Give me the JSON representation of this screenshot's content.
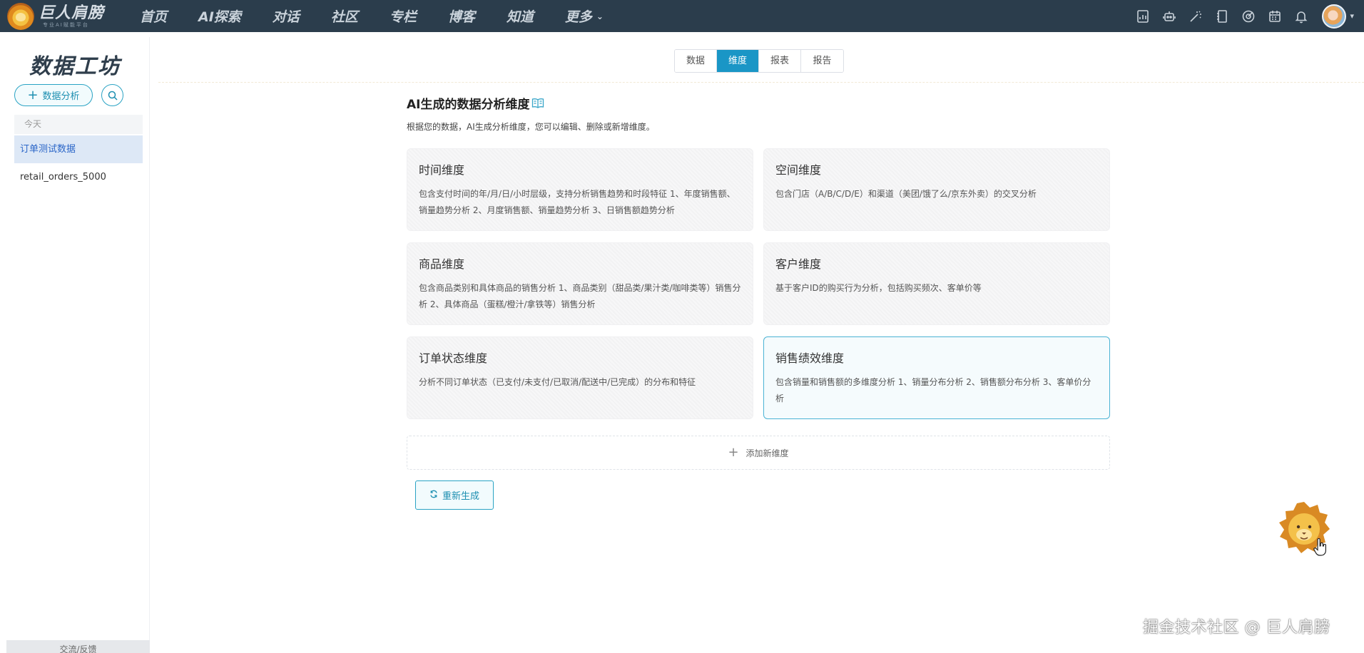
{
  "app": {
    "logo_title": "巨人肩膀",
    "logo_subtitle": "专业AI赋能平台"
  },
  "nav": {
    "items": [
      "首页",
      "AI探索",
      "对话",
      "社区",
      "专栏",
      "博客",
      "知道"
    ],
    "more_label": "更多"
  },
  "top_icons": [
    "report-icon",
    "robot-icon",
    "magic-wand-icon",
    "notebook-icon",
    "target-icon",
    "calendar-icon",
    "bell-icon"
  ],
  "sidebar": {
    "title": "数据工坊",
    "add_button": "数据分析",
    "group_label": "今天",
    "items": [
      "订单测试数据",
      "retail_orders_5000"
    ],
    "footer": "交流/反馈"
  },
  "tabs": {
    "items": [
      "数据",
      "维度",
      "报表",
      "报告"
    ],
    "active": "维度"
  },
  "main": {
    "heading": "AI生成的数据分析维度",
    "description": "根据您的数据，AI生成分析维度，您可以编辑、删除或新增维度。",
    "cards": [
      {
        "title": "时间维度",
        "desc": "包含支付时间的年/月/日/小时层级，支持分析销售趋势和时段特征 1、年度销售额、销量趋势分析 2、月度销售额、销量趋势分析 3、日销售额趋势分析"
      },
      {
        "title": "空间维度",
        "desc": "包含门店（A/B/C/D/E）和渠道（美团/饿了么/京东外卖）的交叉分析"
      },
      {
        "title": "商品维度",
        "desc": "包含商品类别和具体商品的销售分析 1、商品类别（甜品类/果汁类/咖啡类等）销售分析 2、具体商品（蛋糕/橙汁/拿铁等）销售分析"
      },
      {
        "title": "客户维度",
        "desc": "基于客户ID的购买行为分析，包括购买频次、客单价等"
      },
      {
        "title": "订单状态维度",
        "desc": "分析不同订单状态（已支付/未支付/已取消/配送中/已完成）的分布和特征"
      },
      {
        "title": "销售绩效维度",
        "desc": "包含销量和销售额的多维度分析 1、销量分布分析 2、销售额分布分析 3、客单价分析"
      }
    ],
    "add_label": "添加新维度",
    "regen_label": "重新生成"
  },
  "watermark": "掘金技术社区 @ 巨人肩膀",
  "colors": {
    "topbar": "#2b3d4c",
    "accent": "#1a96c6",
    "selected_border": "#4bb3d4"
  }
}
